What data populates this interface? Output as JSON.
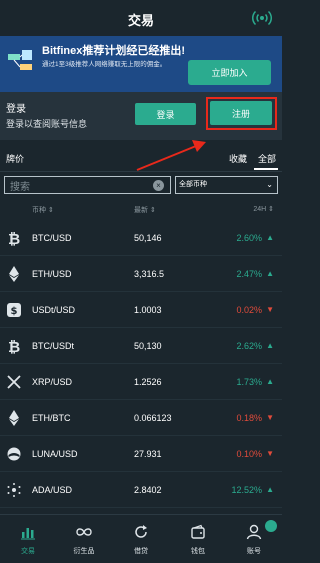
{
  "header": {
    "title": "交易",
    "signal_icon": "signal-broadcast-icon"
  },
  "banner": {
    "title": "Bitfinex推荐计划经已经推出!",
    "subtitle": "通过1至3级推荐人网络赚取无上限的佣金。",
    "button_label": "立即加入"
  },
  "login_panel": {
    "title": "登录",
    "subtitle": "登录以查阅账号信息",
    "login_label": "登录",
    "register_label": "注册"
  },
  "price_tabs": {
    "title": "牌价",
    "favorites_label": "收藏",
    "all_label": "全部"
  },
  "search": {
    "placeholder": "搜索"
  },
  "filter": {
    "selected": "全部币种"
  },
  "columns": {
    "coin": "币种 ⇕",
    "latest": "最新 ⇕",
    "change": "24H ⇕"
  },
  "rows": [
    {
      "icon": "bitcoin-icon",
      "pair": "BTC/USD",
      "price": "50,146",
      "change": "2.60%",
      "direction": "up"
    },
    {
      "icon": "ethereum-icon",
      "pair": "ETH/USD",
      "price": "3,316.5",
      "change": "2.47%",
      "direction": "up"
    },
    {
      "icon": "usdt-icon",
      "pair": "USDt/USD",
      "price": "1.0003",
      "change": "0.02%",
      "direction": "down"
    },
    {
      "icon": "bitcoin-icon",
      "pair": "BTC/USDt",
      "price": "50,130",
      "change": "2.62%",
      "direction": "up"
    },
    {
      "icon": "xrp-icon",
      "pair": "XRP/USD",
      "price": "1.2526",
      "change": "1.73%",
      "direction": "up"
    },
    {
      "icon": "ethereum-icon",
      "pair": "ETH/BTC",
      "price": "0.066123",
      "change": "0.18%",
      "direction": "down"
    },
    {
      "icon": "luna-icon",
      "pair": "LUNA/USD",
      "price": "27.931",
      "change": "0.10%",
      "direction": "down"
    },
    {
      "icon": "cardano-icon",
      "pair": "ADA/USD",
      "price": "2.8402",
      "change": "12.52%",
      "direction": "up"
    }
  ],
  "bottom_nav": [
    {
      "label": "交易",
      "icon": "chart-bars-icon",
      "active": true
    },
    {
      "label": "衍生品",
      "icon": "infinity-icon",
      "active": false
    },
    {
      "label": "借贷",
      "icon": "refresh-icon",
      "active": false
    },
    {
      "label": "钱包",
      "icon": "wallet-icon",
      "active": false
    },
    {
      "label": "账号",
      "icon": "user-icon",
      "active": false
    }
  ],
  "colors": {
    "background": "#1b262d",
    "accent": "#2bab8f",
    "up": "#2bab8f",
    "down": "#e14b3b",
    "banner": "#1e4a86",
    "annotation": "#e8291b"
  }
}
